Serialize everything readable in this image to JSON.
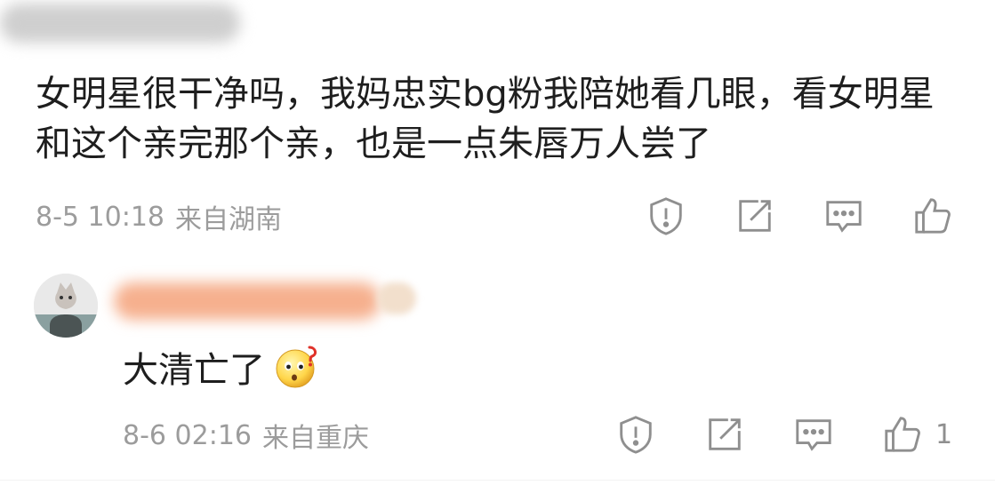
{
  "comment": {
    "text": "女明星很干净吗，我妈忠实bg粉我陪她看几眼，看女明星和这个亲完那个亲，也是一点朱唇万人尝了",
    "time": "8-5 10:18",
    "location": "来自湖南",
    "actions": [
      {
        "icon": "report-icon"
      },
      {
        "icon": "repost-icon"
      },
      {
        "icon": "comment-icon"
      },
      {
        "icon": "like-icon"
      }
    ]
  },
  "reply": {
    "text": "大清亡了",
    "emoji": "surprised-emoji",
    "time": "8-6 02:16",
    "location": "来自重庆",
    "like_count": "1"
  },
  "colors": {
    "meta": "#9c9c9c",
    "icon": "#8f8f8f",
    "redacted_name": "#f6b08e"
  }
}
